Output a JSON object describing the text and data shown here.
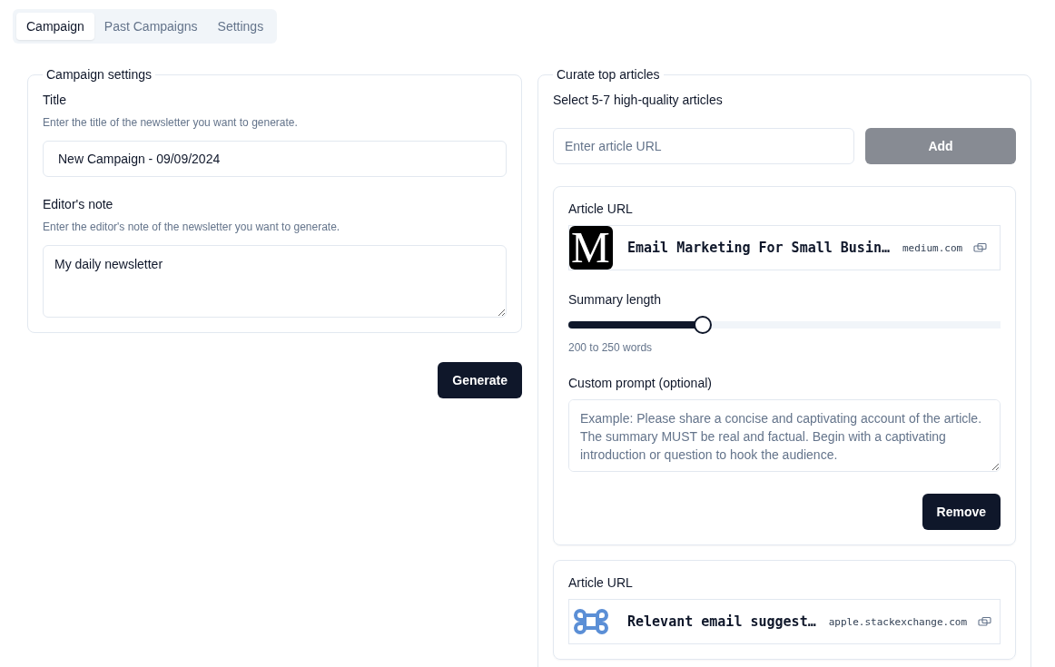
{
  "tabs": [
    {
      "label": "Campaign",
      "selected": true
    },
    {
      "label": "Past Campaigns",
      "selected": false
    },
    {
      "label": "Settings",
      "selected": false
    }
  ],
  "campaign_settings": {
    "legend": "Campaign settings",
    "fields": [
      {
        "kind": "input",
        "label": "Title",
        "hint": "Enter the title of the newsletter you want to generate.",
        "value": "New Campaign - 09/09/2024"
      },
      {
        "kind": "textarea",
        "label": "Editor's note",
        "hint": "Enter the editor's note of the newsletter you want to generate.",
        "value": "My daily newsletter"
      }
    ],
    "button": "Generate"
  },
  "curate": {
    "legend": "Curate top articles",
    "subtitle": "Select 5-7 high-quality articles",
    "url_field": {
      "placeholder": "Enter article URL"
    },
    "add_button": {
      "label": "Add",
      "disabled": true
    },
    "articles": [
      {
        "url_label": "Article URL",
        "kind": "serif-logo",
        "logo_text": "M",
        "title": "Email Marketing For Small Busin…",
        "domain": "medium.com",
        "summary_label": "Summary length",
        "level": 0.31,
        "summary_reading": "200 to 250 words",
        "prompt_label": "Custom prompt (optional)",
        "prompt_placeholder": "Example: Please share a concise and captivating account of the article. The summary MUST be real and factual. Begin with a captivating introduction or question to hook the audience.",
        "remove": "Remove"
      },
      {
        "url_label": "Article URL",
        "kind": "command-logo",
        "title": "Relevant email suggest…",
        "domain": "apple.stackexchange.com"
      }
    ]
  }
}
